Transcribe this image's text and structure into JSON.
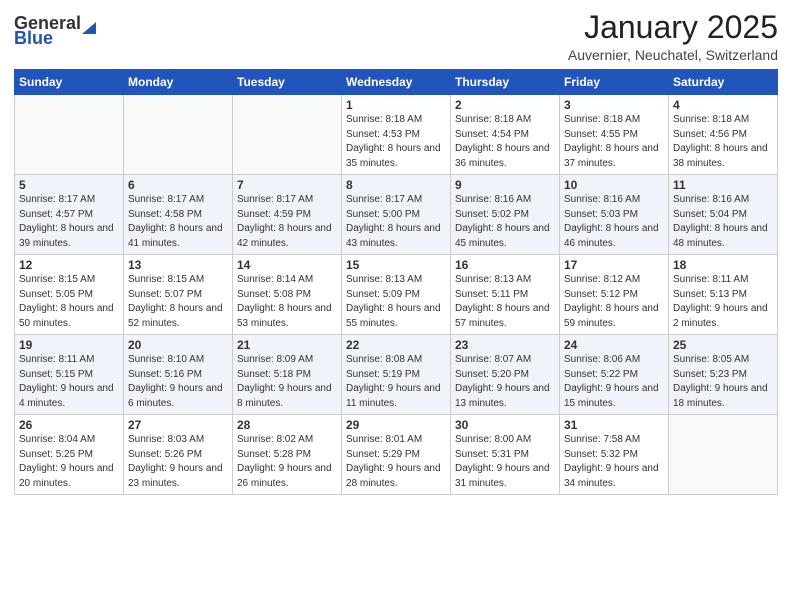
{
  "logo": {
    "general": "General",
    "blue": "Blue"
  },
  "header": {
    "month": "January 2025",
    "location": "Auvernier, Neuchatel, Switzerland"
  },
  "weekdays": [
    "Sunday",
    "Monday",
    "Tuesday",
    "Wednesday",
    "Thursday",
    "Friday",
    "Saturday"
  ],
  "weeks": [
    [
      {
        "num": "",
        "info": ""
      },
      {
        "num": "",
        "info": ""
      },
      {
        "num": "",
        "info": ""
      },
      {
        "num": "1",
        "info": "Sunrise: 8:18 AM\nSunset: 4:53 PM\nDaylight: 8 hours and 35 minutes."
      },
      {
        "num": "2",
        "info": "Sunrise: 8:18 AM\nSunset: 4:54 PM\nDaylight: 8 hours and 36 minutes."
      },
      {
        "num": "3",
        "info": "Sunrise: 8:18 AM\nSunset: 4:55 PM\nDaylight: 8 hours and 37 minutes."
      },
      {
        "num": "4",
        "info": "Sunrise: 8:18 AM\nSunset: 4:56 PM\nDaylight: 8 hours and 38 minutes."
      }
    ],
    [
      {
        "num": "5",
        "info": "Sunrise: 8:17 AM\nSunset: 4:57 PM\nDaylight: 8 hours and 39 minutes."
      },
      {
        "num": "6",
        "info": "Sunrise: 8:17 AM\nSunset: 4:58 PM\nDaylight: 8 hours and 41 minutes."
      },
      {
        "num": "7",
        "info": "Sunrise: 8:17 AM\nSunset: 4:59 PM\nDaylight: 8 hours and 42 minutes."
      },
      {
        "num": "8",
        "info": "Sunrise: 8:17 AM\nSunset: 5:00 PM\nDaylight: 8 hours and 43 minutes."
      },
      {
        "num": "9",
        "info": "Sunrise: 8:16 AM\nSunset: 5:02 PM\nDaylight: 8 hours and 45 minutes."
      },
      {
        "num": "10",
        "info": "Sunrise: 8:16 AM\nSunset: 5:03 PM\nDaylight: 8 hours and 46 minutes."
      },
      {
        "num": "11",
        "info": "Sunrise: 8:16 AM\nSunset: 5:04 PM\nDaylight: 8 hours and 48 minutes."
      }
    ],
    [
      {
        "num": "12",
        "info": "Sunrise: 8:15 AM\nSunset: 5:05 PM\nDaylight: 8 hours and 50 minutes."
      },
      {
        "num": "13",
        "info": "Sunrise: 8:15 AM\nSunset: 5:07 PM\nDaylight: 8 hours and 52 minutes."
      },
      {
        "num": "14",
        "info": "Sunrise: 8:14 AM\nSunset: 5:08 PM\nDaylight: 8 hours and 53 minutes."
      },
      {
        "num": "15",
        "info": "Sunrise: 8:13 AM\nSunset: 5:09 PM\nDaylight: 8 hours and 55 minutes."
      },
      {
        "num": "16",
        "info": "Sunrise: 8:13 AM\nSunset: 5:11 PM\nDaylight: 8 hours and 57 minutes."
      },
      {
        "num": "17",
        "info": "Sunrise: 8:12 AM\nSunset: 5:12 PM\nDaylight: 8 hours and 59 minutes."
      },
      {
        "num": "18",
        "info": "Sunrise: 8:11 AM\nSunset: 5:13 PM\nDaylight: 9 hours and 2 minutes."
      }
    ],
    [
      {
        "num": "19",
        "info": "Sunrise: 8:11 AM\nSunset: 5:15 PM\nDaylight: 9 hours and 4 minutes."
      },
      {
        "num": "20",
        "info": "Sunrise: 8:10 AM\nSunset: 5:16 PM\nDaylight: 9 hours and 6 minutes."
      },
      {
        "num": "21",
        "info": "Sunrise: 8:09 AM\nSunset: 5:18 PM\nDaylight: 9 hours and 8 minutes."
      },
      {
        "num": "22",
        "info": "Sunrise: 8:08 AM\nSunset: 5:19 PM\nDaylight: 9 hours and 11 minutes."
      },
      {
        "num": "23",
        "info": "Sunrise: 8:07 AM\nSunset: 5:20 PM\nDaylight: 9 hours and 13 minutes."
      },
      {
        "num": "24",
        "info": "Sunrise: 8:06 AM\nSunset: 5:22 PM\nDaylight: 9 hours and 15 minutes."
      },
      {
        "num": "25",
        "info": "Sunrise: 8:05 AM\nSunset: 5:23 PM\nDaylight: 9 hours and 18 minutes."
      }
    ],
    [
      {
        "num": "26",
        "info": "Sunrise: 8:04 AM\nSunset: 5:25 PM\nDaylight: 9 hours and 20 minutes."
      },
      {
        "num": "27",
        "info": "Sunrise: 8:03 AM\nSunset: 5:26 PM\nDaylight: 9 hours and 23 minutes."
      },
      {
        "num": "28",
        "info": "Sunrise: 8:02 AM\nSunset: 5:28 PM\nDaylight: 9 hours and 26 minutes."
      },
      {
        "num": "29",
        "info": "Sunrise: 8:01 AM\nSunset: 5:29 PM\nDaylight: 9 hours and 28 minutes."
      },
      {
        "num": "30",
        "info": "Sunrise: 8:00 AM\nSunset: 5:31 PM\nDaylight: 9 hours and 31 minutes."
      },
      {
        "num": "31",
        "info": "Sunrise: 7:58 AM\nSunset: 5:32 PM\nDaylight: 9 hours and 34 minutes."
      },
      {
        "num": "",
        "info": ""
      }
    ]
  ]
}
